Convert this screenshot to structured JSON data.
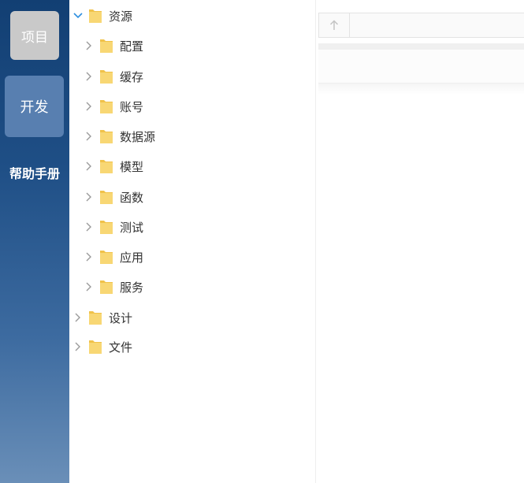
{
  "sidebar": {
    "project_label": "项目",
    "develop_label": "开发",
    "help_label": "帮助手册"
  },
  "tree": {
    "root": "资源",
    "children": [
      "配置",
      "缓存",
      "账号",
      "数据源",
      "模型",
      "函数",
      "测试",
      "应用",
      "服务"
    ],
    "siblings": [
      "设计",
      "文件"
    ]
  },
  "table": {
    "sort_icon": "arrow-up-icon"
  },
  "colors": {
    "rail_top": "#123f73",
    "rail_bottom": "#6a8fb8",
    "folder": "#f5cf5b",
    "chevron": "#9a9a9a",
    "chevron_open": "#2d8fe0"
  }
}
